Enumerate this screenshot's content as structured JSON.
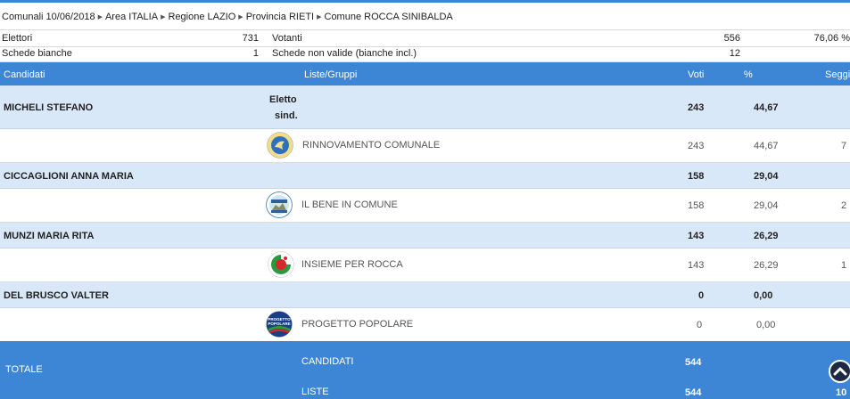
{
  "breadcrumb": [
    "Comunali 10/06/2018",
    "Area ITALIA",
    "Regione LAZIO",
    "Provincia RIETI",
    "Comune ROCCA SINIBALDA"
  ],
  "summary": {
    "elettori_label": "Elettori",
    "elettori_value": "731",
    "votanti_label": "Votanti",
    "votanti_value": "556",
    "votanti_pct": "76,06 %",
    "bianche_label": "Schede bianche",
    "bianche_value": "1",
    "non_valide_label": "Schede non valide (bianche incl.)",
    "non_valide_value": "12"
  },
  "columns": {
    "candidati": "Candidati",
    "liste": "Liste/Gruppi",
    "voti": "Voti",
    "pct": "%",
    "seggi": "Seggi"
  },
  "candidates": [
    {
      "name": "MICHELI STEFANO",
      "status_line1": "Eletto",
      "status_line2": "sind.",
      "voti": "243",
      "pct": "44,67",
      "list": {
        "name": "RINNOVAMENTO COMUNALE",
        "logo": "rinnovamento-logo",
        "voti": "243",
        "pct": "44,67",
        "seggi": "7"
      }
    },
    {
      "name": "CICCAGLIONI ANNA MARIA",
      "voti": "158",
      "pct": "29,04",
      "list": {
        "name": "IL BENE IN COMUNE",
        "logo": "bene-in-comune-logo",
        "voti": "158",
        "pct": "29,04",
        "seggi": "2"
      }
    },
    {
      "name": "MUNZI MARIA RITA",
      "voti": "143",
      "pct": "26,29",
      "list": {
        "name": "INSIEME PER ROCCA",
        "logo": "insieme-per-rocca-logo",
        "voti": "143",
        "pct": "26,29",
        "seggi": "1"
      }
    },
    {
      "name": "DEL BRUSCO VALTER",
      "voti": "0",
      "pct": "0,00",
      "list": {
        "name": "PROGETTO POPOLARE",
        "logo": "progetto-popolare-logo",
        "logo_text1": "PROGETTO",
        "logo_text2": "POPOLARE",
        "voti": "0",
        "pct": "0,00",
        "seggi": ""
      }
    }
  ],
  "totals": {
    "label": "TOTALE",
    "candidati_label": "CANDIDATI",
    "candidati_voti": "544",
    "liste_label": "LISTE",
    "liste_voti": "544",
    "liste_seggi": "10"
  },
  "colors": {
    "accent": "#3d86d6",
    "candidate_row": "#d9e8f8",
    "scroll_button": "#1e2a44"
  }
}
